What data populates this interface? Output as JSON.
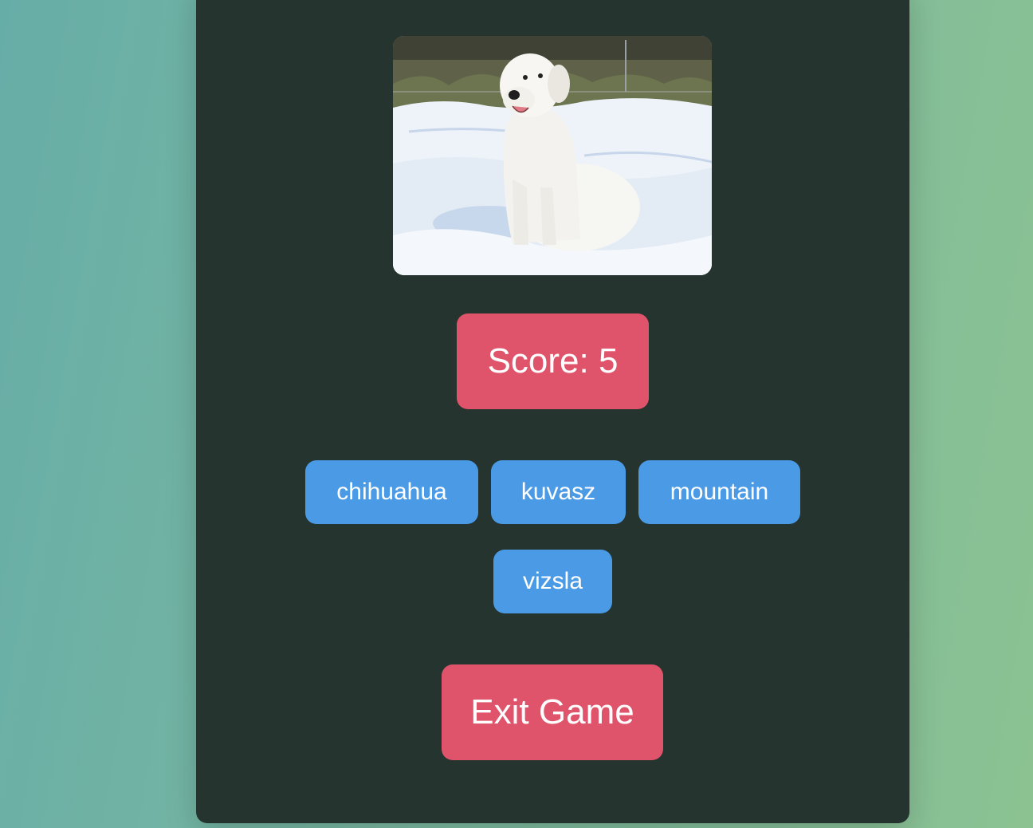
{
  "game": {
    "image_alt": "dog photo",
    "score_text": "Score: 5",
    "choices": [
      {
        "label": "chihuahua"
      },
      {
        "label": "kuvasz"
      },
      {
        "label": "mountain"
      },
      {
        "label": "vizsla"
      }
    ],
    "exit_label": "Exit Game"
  },
  "colors": {
    "background_start": "#67ada7",
    "background_end": "#8cc292",
    "card": "#25342f",
    "score_and_exit": "#df546a",
    "choice": "#4b9ae5",
    "text": "#ffffff"
  }
}
